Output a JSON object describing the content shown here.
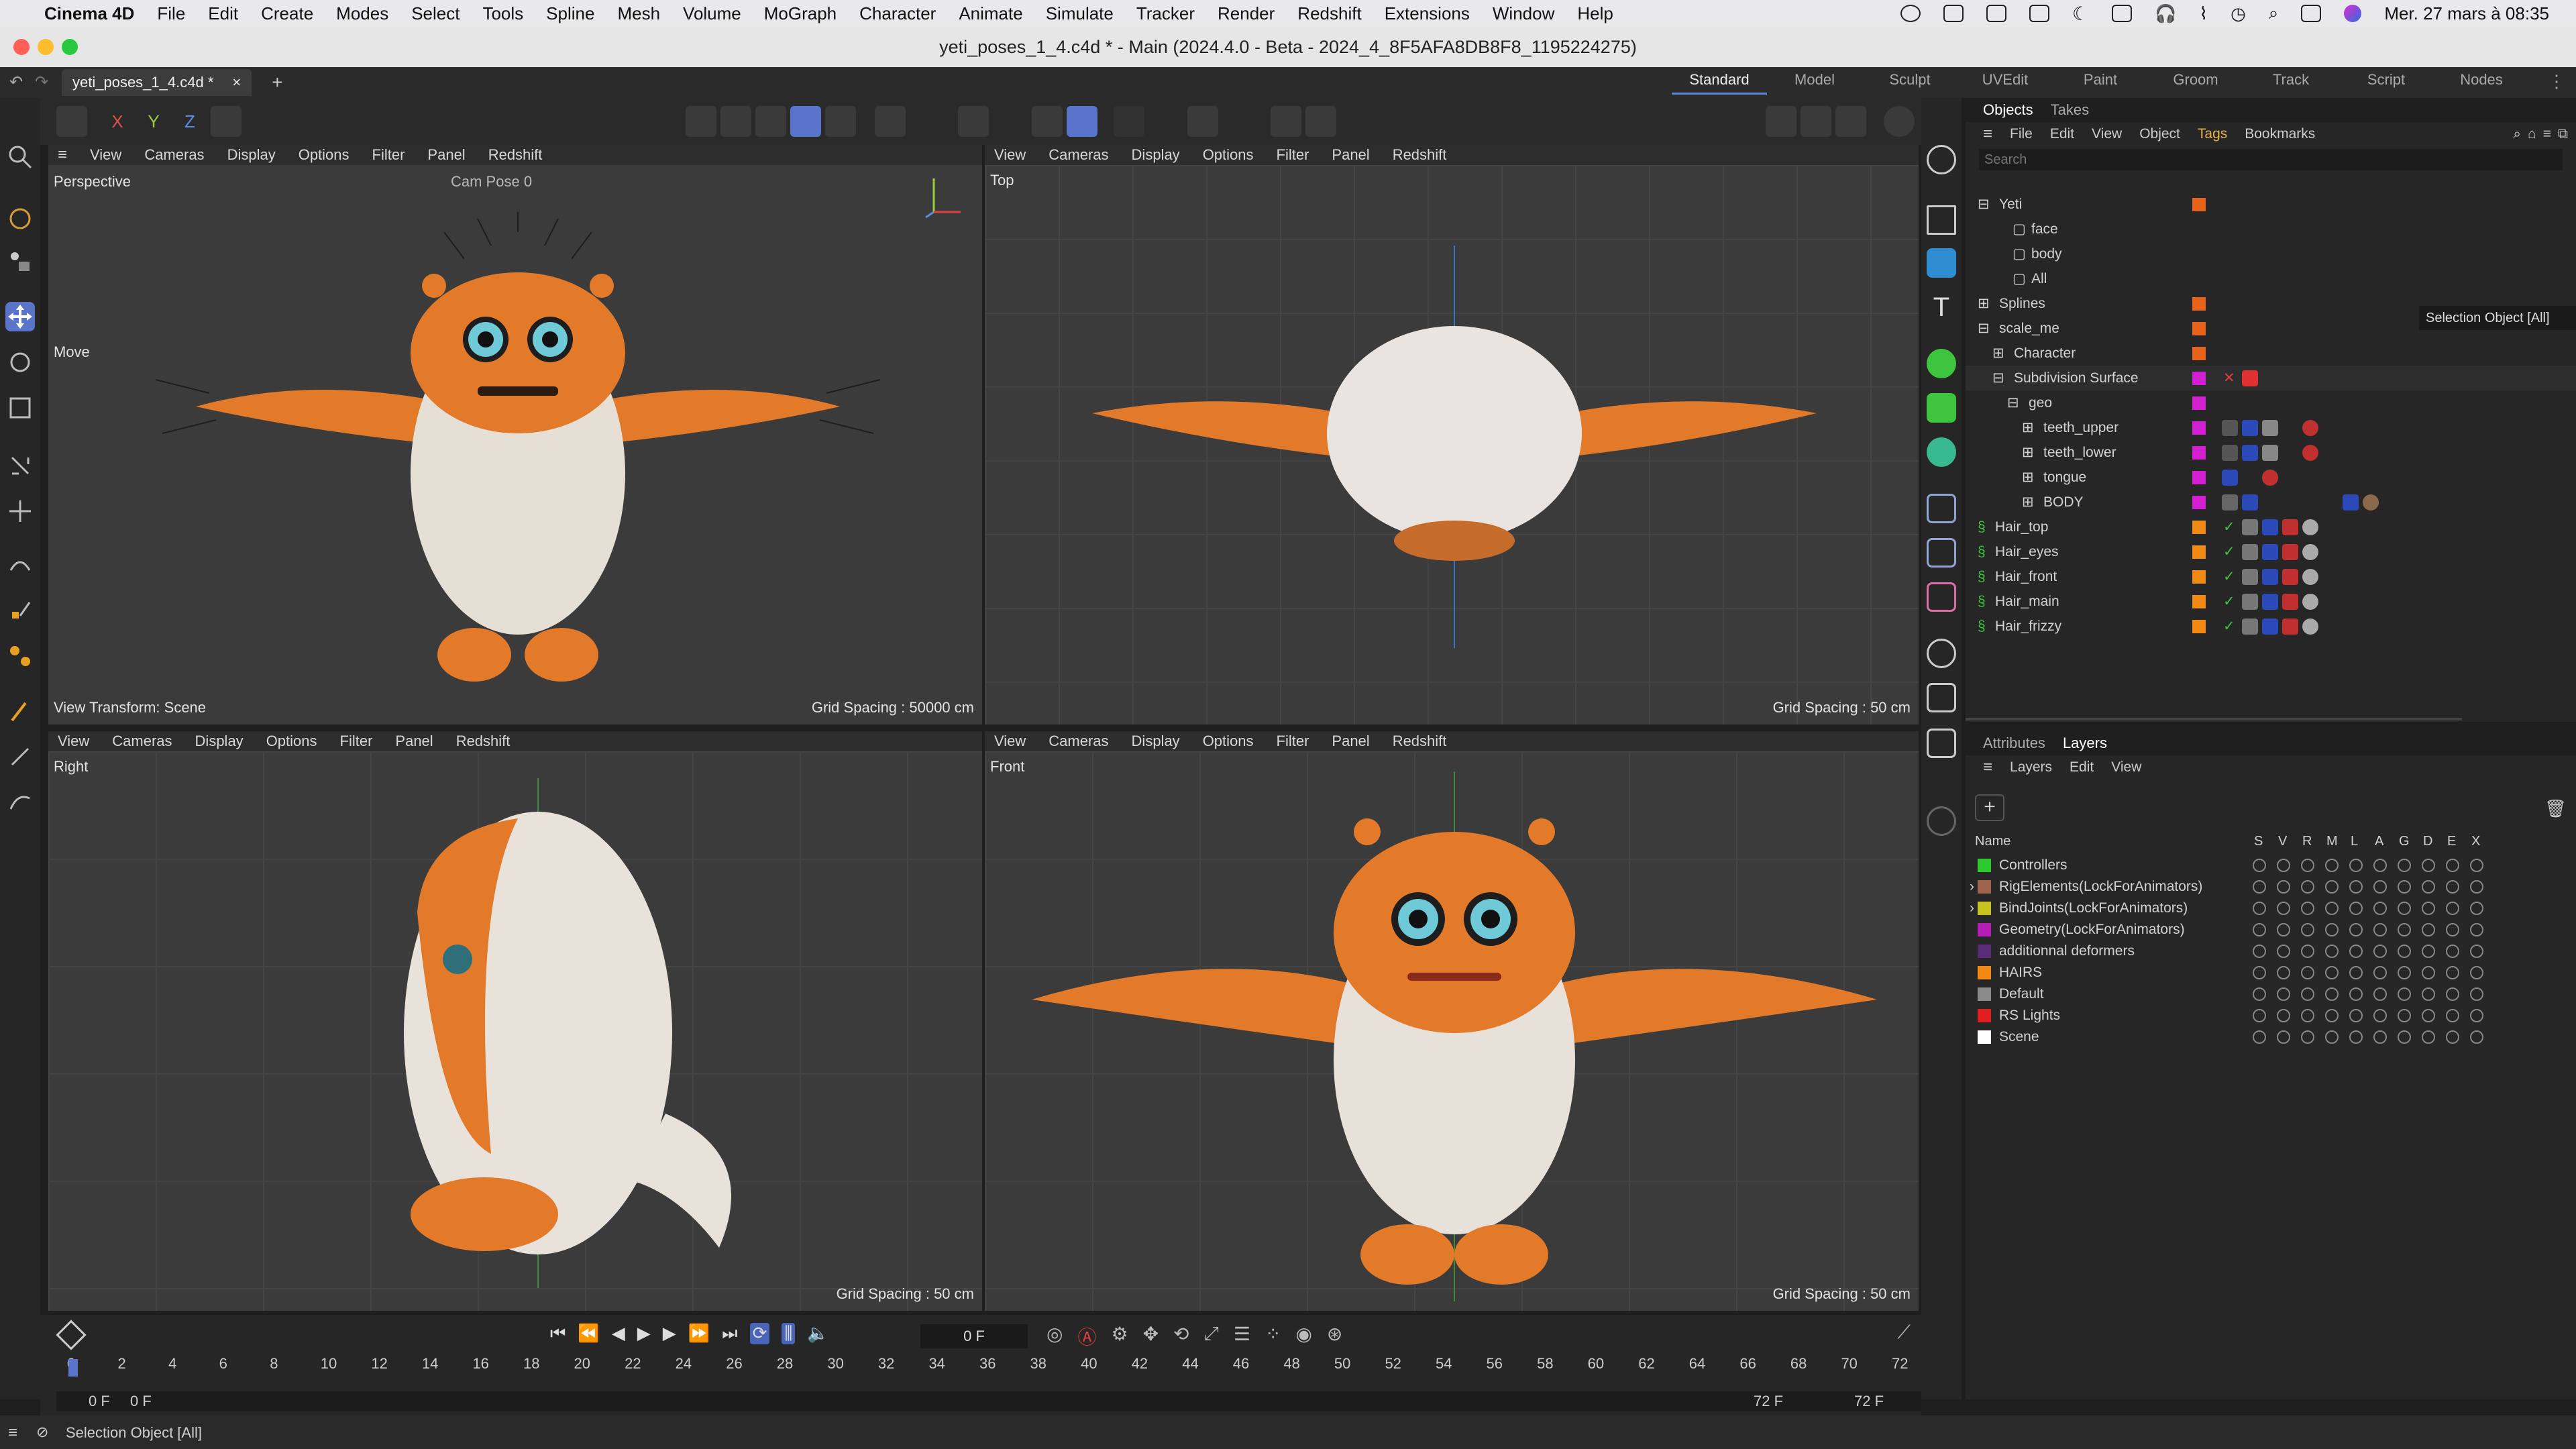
{
  "menubar": {
    "app": "Cinema 4D",
    "items": [
      "File",
      "Edit",
      "Create",
      "Modes",
      "Select",
      "Tools",
      "Spline",
      "Mesh",
      "Volume",
      "MoGraph",
      "Character",
      "Animate",
      "Simulate",
      "Tracker",
      "Render",
      "Redshift",
      "Extensions",
      "Window",
      "Help"
    ],
    "datetime": "Mer. 27 mars à 08:35"
  },
  "window": {
    "title": "yeti_poses_1_4.c4d * - Main (2024.4.0 - Beta - 2024_4_8F5AFA8DB8F8_1195224275)"
  },
  "doc_tab": {
    "label": "yeti_poses_1_4.c4d *",
    "close": "×",
    "add": "+"
  },
  "layouts": [
    "Standard",
    "Model",
    "Sculpt",
    "UVEdit",
    "Paint",
    "Groom",
    "Track",
    "Script",
    "Nodes"
  ],
  "axis_buttons": [
    "X",
    "Y",
    "Z"
  ],
  "viewport_menu": [
    "View",
    "Cameras",
    "Display",
    "Options",
    "Filter",
    "Panel",
    "Redshift"
  ],
  "viewports": [
    {
      "name": "Perspective",
      "camera": "Cam Pose 0",
      "footer_left": "View Transform: Scene",
      "grid": "Grid Spacing : 50000 cm",
      "tool": "Move"
    },
    {
      "name": "Top",
      "grid": "Grid Spacing : 50 cm"
    },
    {
      "name": "Right",
      "grid": "Grid Spacing : 50 cm"
    },
    {
      "name": "Front",
      "grid": "Grid Spacing : 50 cm"
    }
  ],
  "objects_panel": {
    "tabs": [
      "Objects",
      "Takes"
    ],
    "menu": [
      "File",
      "Edit",
      "View",
      "Object",
      "Tags",
      "Bookmarks"
    ],
    "search_placeholder": "Search",
    "tooltip": "Selection Object [All]"
  },
  "objects": [
    {
      "name": "Yeti",
      "indent": 0,
      "color": "#e8631a"
    },
    {
      "name": "face",
      "indent": 1,
      "color": ""
    },
    {
      "name": "body",
      "indent": 1,
      "color": ""
    },
    {
      "name": "All",
      "indent": 1,
      "color": ""
    },
    {
      "name": "Splines",
      "indent": 0,
      "color": "#e8631a"
    },
    {
      "name": "scale_me",
      "indent": 0,
      "color": "#e8631a"
    },
    {
      "name": "Character",
      "indent": 1,
      "color": "#e8631a"
    },
    {
      "name": "Subdivision Surface",
      "indent": 1,
      "color": "#d21fd2"
    },
    {
      "name": "geo",
      "indent": 2,
      "color": "#d21fd2"
    },
    {
      "name": "teeth_upper",
      "indent": 3,
      "color": "#d21fd2"
    },
    {
      "name": "teeth_lower",
      "indent": 3,
      "color": "#d21fd2"
    },
    {
      "name": "tongue",
      "indent": 3,
      "color": "#d21fd2"
    },
    {
      "name": "BODY",
      "indent": 3,
      "color": "#d21fd2"
    },
    {
      "name": "Hair_top",
      "indent": 0,
      "color": "#f08a14"
    },
    {
      "name": "Hair_eyes",
      "indent": 0,
      "color": "#f08a14"
    },
    {
      "name": "Hair_front",
      "indent": 0,
      "color": "#f08a14"
    },
    {
      "name": "Hair_main",
      "indent": 0,
      "color": "#f08a14"
    },
    {
      "name": "Hair_frizzy",
      "indent": 0,
      "color": "#f08a14"
    }
  ],
  "layers_panel": {
    "tabs": [
      "Attributes",
      "Layers"
    ],
    "menu": [
      "Layers",
      "Edit",
      "View"
    ],
    "col_name": "Name",
    "cols": [
      "S",
      "V",
      "R",
      "M",
      "L",
      "A",
      "G",
      "D",
      "E",
      "X"
    ]
  },
  "layers": [
    {
      "name": "Controllers",
      "color": "#2ec92e"
    },
    {
      "name": "RigElements(LockForAnimators)",
      "color": "#a0624a"
    },
    {
      "name": "BindJoints(LockForAnimators)",
      "color": "#c7c21f"
    },
    {
      "name": "Geometry(LockForAnimators)",
      "color": "#b41eb4"
    },
    {
      "name": "additionnal deformers",
      "color": "#5a2c78"
    },
    {
      "name": "HAIRS",
      "color": "#f08a14"
    },
    {
      "name": "Default",
      "color": "#8a8a8a"
    },
    {
      "name": "RS Lights",
      "color": "#e02020"
    },
    {
      "name": "Scene",
      "color": "#ffffff"
    }
  ],
  "timeline": {
    "current": "0 F",
    "start": "0 F",
    "start2": "0 F",
    "end": "72 F",
    "end2": "72 F",
    "ticks": [
      "0",
      "2",
      "4",
      "6",
      "8",
      "10",
      "12",
      "14",
      "16",
      "18",
      "20",
      "22",
      "24",
      "26",
      "28",
      "30",
      "32",
      "34",
      "36",
      "38",
      "40",
      "42",
      "44",
      "46",
      "48",
      "50",
      "52",
      "54",
      "56",
      "58",
      "60",
      "62",
      "64",
      "66",
      "68",
      "70",
      "72"
    ]
  },
  "status": {
    "text": "Selection Object [All]"
  },
  "colors": {
    "accent": "#5a74c9",
    "yeti_orange": "#f07a1a"
  }
}
